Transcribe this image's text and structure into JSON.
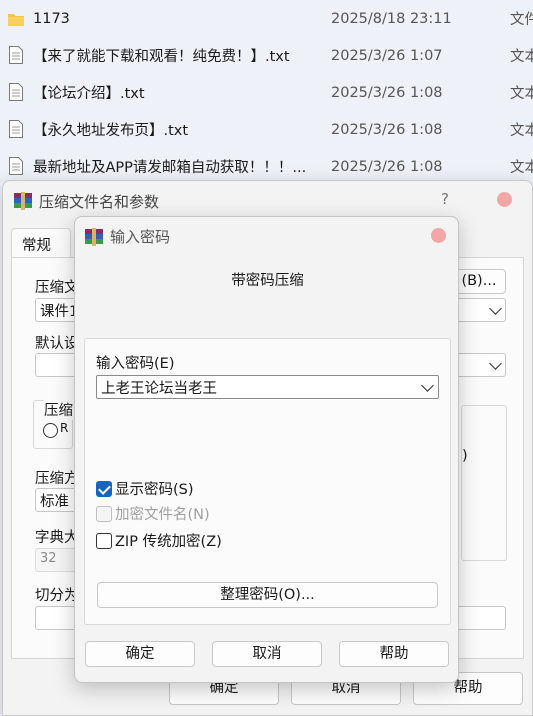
{
  "file_list": [
    {
      "name": "1173",
      "date": "2025/8/18 23:11",
      "type": "文件",
      "icon": "folder-icon"
    },
    {
      "name": "【来了就能下载和观看！纯免费！】.txt",
      "date": "2025/3/26 1:07",
      "type": "文本",
      "icon": "text-file-icon"
    },
    {
      "name": "【论坛介绍】.txt",
      "date": "2025/3/26 1:08",
      "type": "文本",
      "icon": "text-file-icon"
    },
    {
      "name": "【永久地址发布页】.txt",
      "date": "2025/3/26 1:08",
      "type": "文本",
      "icon": "text-file-icon"
    },
    {
      "name": "最新地址及APP请发邮箱自动获取！！！...",
      "date": "2025/3/26 1:08",
      "type": "文本",
      "icon": "text-file-icon"
    }
  ],
  "archive_dialog": {
    "title": "压缩文件名和参数",
    "help_label": "?",
    "tab_general": "常规",
    "archive_name_label": "压缩文",
    "archive_name_value": "课件1",
    "browse_button": "(B)...",
    "default_settings_label": "默认设",
    "format_group_label": "压缩",
    "format_radio_label": "R",
    "method_label": "压缩方",
    "method_value": "标准",
    "dict_label": "字典大",
    "dict_value": "32",
    "split_label": "切分为",
    "options_partial": ")",
    "ok_button": "确定",
    "cancel_button": "取消",
    "help_button": "帮助"
  },
  "password_dialog": {
    "title": "输入密码",
    "subtitle": "带密码压缩",
    "password_label": "输入密码(E)",
    "password_value": "上老王论坛当老王",
    "show_password": {
      "label": "显示密码(S)",
      "checked": true,
      "enabled": true
    },
    "encrypt_filenames": {
      "label": "加密文件名(N)",
      "checked": false,
      "enabled": false
    },
    "zip_legacy": {
      "label": "ZIP 传统加密(Z)",
      "checked": false,
      "enabled": true
    },
    "organize_button": "整理密码(O)...",
    "ok_button": "确定",
    "cancel_button": "取消",
    "help_button": "帮助"
  },
  "colors": {
    "accent": "#1565c0",
    "close_dot": "#f1a7a5",
    "window_bg": "#f3f3f3",
    "list_bg": "#eff1f8"
  }
}
